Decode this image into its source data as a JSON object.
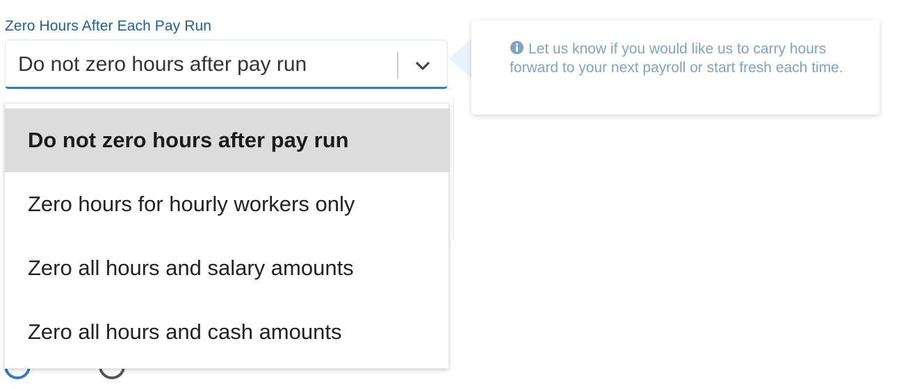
{
  "field": {
    "label": "Zero Hours After Each Pay Run",
    "selected_value": "Do not zero hours after pay run"
  },
  "dropdown": {
    "options": [
      {
        "label": "Do not zero hours after pay run",
        "selected": true
      },
      {
        "label": "Zero hours for hourly workers only",
        "selected": false
      },
      {
        "label": "Zero all hours and salary amounts",
        "selected": false
      },
      {
        "label": "Zero all hours and cash amounts",
        "selected": false
      }
    ]
  },
  "help": {
    "icon": "info-circle-icon",
    "text": "Let us know if you would like us to carry hours forward to your next payroll or start fresh each time."
  },
  "colors": {
    "label_blue": "#1d5fa0",
    "focus_blue": "#2a7cc7",
    "selected_option_bg": "#dcdcdc",
    "help_text": "#7fa3c6"
  }
}
